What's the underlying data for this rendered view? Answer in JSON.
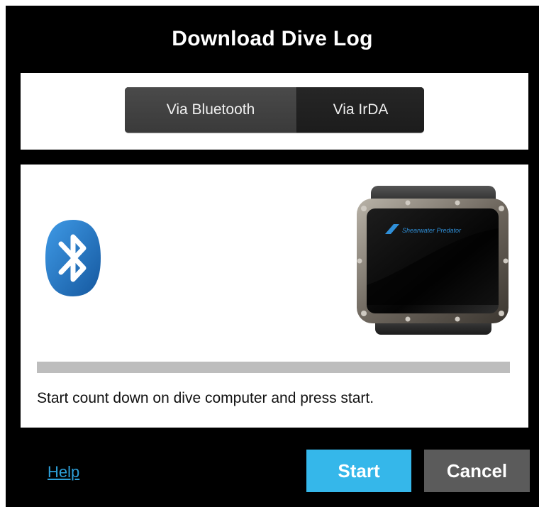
{
  "dialog": {
    "title": "Download Dive Log"
  },
  "tabs": [
    {
      "label": "Via Bluetooth",
      "selected": true
    },
    {
      "label": "Via IrDA",
      "selected": false
    }
  ],
  "device": {
    "brand_text": "Shearwater Predator"
  },
  "progress": {
    "fraction": 0
  },
  "status_text": "Start count down on dive computer and press start.",
  "footer": {
    "help_label": "Help",
    "start_label": "Start",
    "cancel_label": "Cancel"
  },
  "colors": {
    "accent": "#35b7ea",
    "cancel": "#5b5b5b",
    "link": "#2d9fd8",
    "bluetooth": "#1f74c6"
  }
}
